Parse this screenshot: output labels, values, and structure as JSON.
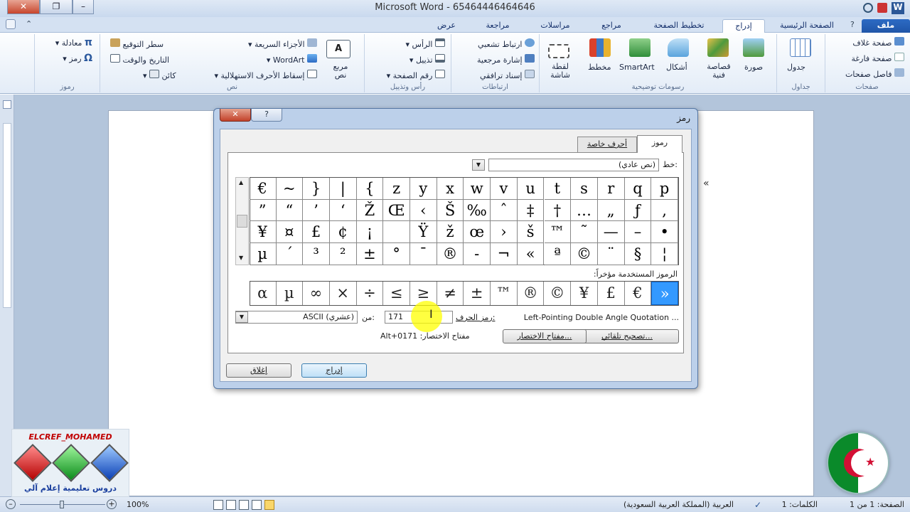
{
  "window": {
    "title": "Microsoft Word  -  65464446464646",
    "minimize": "–",
    "restore": "❐",
    "close": "✕"
  },
  "tabs": [
    "ملف",
    "الصفحة الرئيسية",
    "إدراج",
    "تخطيط الصفحة",
    "مراجع",
    "مراسلات",
    "مراجعة",
    "عرض"
  ],
  "ribbon": {
    "pages": {
      "label": "صفحات",
      "items": [
        "صفحة غلاف",
        "صفحة فارغة",
        "فاصل صفحات"
      ]
    },
    "tables": {
      "label": "جداول",
      "items": [
        "جدول"
      ]
    },
    "illustrations": {
      "label": "رسومات توضيحية",
      "items": [
        "صورة",
        "قصاصة فنية",
        "أشكال",
        "SmartArt",
        "مخطط",
        "لقطة شاشة"
      ]
    },
    "links": {
      "label": "ارتباطات",
      "items": [
        "ارتباط تشعبي",
        "إشارة مرجعية",
        "إسناد ترافقي"
      ]
    },
    "header_footer": {
      "label": "رأس وتذييل",
      "items": [
        "الرأس",
        "تذييل",
        "رقم الصفحة"
      ]
    },
    "text": {
      "label": "نص",
      "textbox": "مربع نص",
      "items": [
        "الأجزاء السريعة",
        "WordArt",
        "إسقاط الأحرف الاستهلالية",
        "سطر التوقيع",
        "التاريخ والوقت",
        "كائن"
      ]
    },
    "symbols": {
      "label": "رموز",
      "items": [
        "معادلة",
        "رمز"
      ]
    }
  },
  "dialog": {
    "title": "رمز",
    "help": "?",
    "close": "✕",
    "tabs": [
      "رموز",
      "أحرف خاصة"
    ],
    "font_label": "خط:",
    "font_value": "(نص عادي)",
    "grid": [
      [
        "p",
        "q",
        "r",
        "s",
        "t",
        "u",
        "v",
        "w",
        "x",
        "y",
        "z",
        "{",
        "|",
        "}",
        "~",
        "€"
      ],
      [
        ",",
        "ƒ",
        "„",
        "…",
        "†",
        "‡",
        "ˆ",
        "‰",
        "Š",
        "‹",
        "Œ",
        "Ž",
        "‘",
        "’",
        "“",
        "”"
      ],
      [
        "•",
        "–",
        "—",
        "˜",
        "™",
        "š",
        "›",
        "œ",
        "ž",
        "Ÿ",
        " ",
        "¡",
        "¢",
        "£",
        "¤",
        "¥"
      ],
      [
        "¦",
        "§",
        "¨",
        "©",
        "ª",
        "«",
        "¬",
        "-",
        "®",
        "¯",
        "°",
        "±",
        "²",
        "³",
        "´",
        "µ"
      ]
    ],
    "recent_label": "الرموز المستخدمة مؤخراً:",
    "recent": [
      "»",
      "€",
      "£",
      "¥",
      "©",
      "®",
      "™",
      "±",
      "≠",
      "≥",
      "≤",
      "÷",
      "×",
      "∞",
      "µ",
      "α"
    ],
    "char_name": "Left-Pointing Double Angle Quotation ...",
    "char_code_label": "رمز الحرف:",
    "char_code": "171",
    "from_label": "من:",
    "from_value": "ASCII (عشري)",
    "autocorrect": "تصحيح تلقائي...",
    "shortcut_key": "مفتاح الاختصار...",
    "shortcut_label": "مفتاح الاختصار: Alt+0171",
    "insert": "إدراج",
    "cancel": "إغلاق"
  },
  "status": {
    "page": "الصفحة: 1 من 1",
    "words": "الكلمات: 1",
    "language": "العربية (المملكة العربية السعودية)",
    "zoom": "100%"
  },
  "watermark": {
    "channel": "ELCREF_MOHAMED",
    "subtitle": "دروس تعليمية إعلام آلي"
  },
  "colors": {
    "accent": "#2d6bc4",
    "selection": "#3399ff",
    "highlight": "#ffff00"
  }
}
